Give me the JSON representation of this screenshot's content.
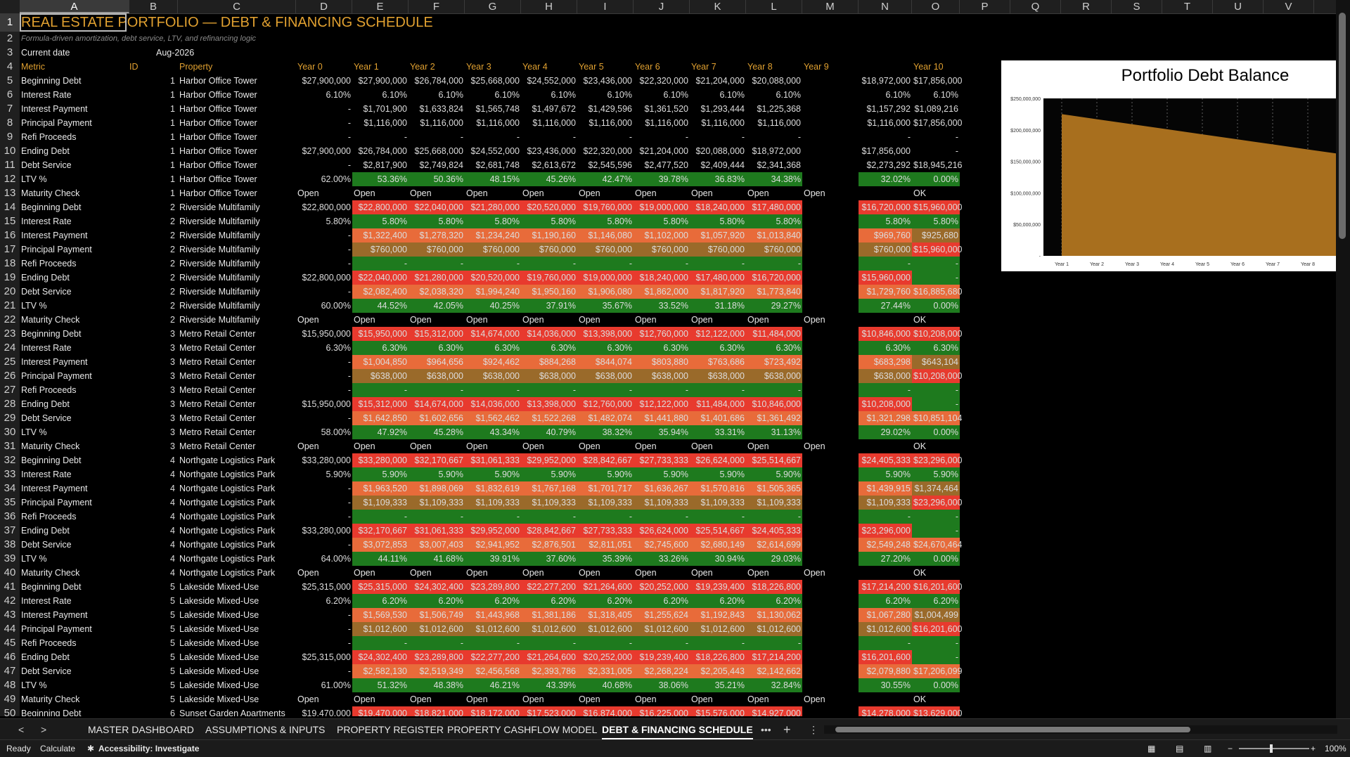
{
  "columns": [
    "A",
    "B",
    "C",
    "D",
    "E",
    "F",
    "G",
    "H",
    "I",
    "J",
    "K",
    "L",
    "M",
    "N",
    "O",
    "P",
    "Q",
    "R",
    "S",
    "T",
    "U",
    "V"
  ],
  "title": "REAL ESTATE PORTFOLIO — DEBT & FINANCING SCHEDULE",
  "subtitle": "Formula-driven amortization, debt service, LTV, and refinancing logic",
  "current_date_label": "Current date",
  "current_date_value": "Aug-2026",
  "headers": [
    "Metric",
    "ID",
    "Property",
    "Year 0",
    "Year 1",
    "Year 2",
    "Year 3",
    "Year 4",
    "Year 5",
    "Year 6",
    "Year 7",
    "Year 8",
    "Year 9",
    "",
    "Year 10"
  ],
  "colors": {
    "red": "#e83a2e",
    "orange": "#e86b3a",
    "olive": "#9a6a2a",
    "green": "#1e7a1e",
    "gold": "#e0a030"
  },
  "properties": [
    {
      "id": "1",
      "name": "Harbor Office Tower",
      "rows": [
        {
          "metric": "Beginning Debt",
          "y0": "$27,900,000",
          "vals": [
            "$27,900,000",
            "$26,784,000",
            "$25,668,000",
            "$24,552,000",
            "$23,436,000",
            "$22,320,000",
            "$21,204,000",
            "$20,088,000",
            "",
            "$18,972,000",
            "$17,856,000"
          ]
        },
        {
          "metric": "Interest Rate",
          "y0": "6.10%",
          "vals": [
            "6.10%",
            "6.10%",
            "6.10%",
            "6.10%",
            "6.10%",
            "6.10%",
            "6.10%",
            "6.10%",
            "",
            "6.10%",
            "6.10%"
          ]
        },
        {
          "metric": "Interest Payment",
          "y0": "-",
          "vals": [
            "$1,701,900",
            "$1,633,824",
            "$1,565,748",
            "$1,497,672",
            "$1,429,596",
            "$1,361,520",
            "$1,293,444",
            "$1,225,368",
            "",
            "$1,157,292",
            "$1,089,216"
          ]
        },
        {
          "metric": "Principal Payment",
          "y0": "-",
          "vals": [
            "$1,116,000",
            "$1,116,000",
            "$1,116,000",
            "$1,116,000",
            "$1,116,000",
            "$1,116,000",
            "$1,116,000",
            "$1,116,000",
            "",
            "$1,116,000",
            "$17,856,000"
          ]
        },
        {
          "metric": "Refi Proceeds",
          "y0": "-",
          "vals": [
            "-",
            "-",
            "-",
            "-",
            "-",
            "-",
            "-",
            "-",
            "",
            "-",
            "-"
          ]
        },
        {
          "metric": "Ending Debt",
          "y0": "$27,900,000",
          "vals": [
            "$26,784,000",
            "$25,668,000",
            "$24,552,000",
            "$23,436,000",
            "$22,320,000",
            "$21,204,000",
            "$20,088,000",
            "$18,972,000",
            "",
            "$17,856,000",
            "-"
          ]
        },
        {
          "metric": "Debt Service",
          "y0": "-",
          "vals": [
            "$2,817,900",
            "$2,749,824",
            "$2,681,748",
            "$2,613,672",
            "$2,545,596",
            "$2,477,520",
            "$2,409,444",
            "$2,341,368",
            "",
            "$2,273,292",
            "$18,945,216"
          ]
        },
        {
          "metric": "LTV %",
          "y0": "62.00%",
          "vals": [
            "53.36%",
            "50.36%",
            "48.15%",
            "45.26%",
            "42.47%",
            "39.78%",
            "36.83%",
            "34.38%",
            "",
            "32.02%",
            "0.00%"
          ]
        },
        {
          "metric": "Maturity Check",
          "y0": "Open",
          "vals": [
            "Open",
            "Open",
            "Open",
            "Open",
            "Open",
            "Open",
            "Open",
            "Open",
            "Open",
            "",
            "OK"
          ]
        }
      ]
    },
    {
      "id": "2",
      "name": "Riverside Multifamily",
      "rows": [
        {
          "metric": "Beginning Debt",
          "y0": "$22,800,000",
          "vals": [
            "$22,800,000",
            "$22,040,000",
            "$21,280,000",
            "$20,520,000",
            "$19,760,000",
            "$19,000,000",
            "$18,240,000",
            "$17,480,000",
            "",
            "$16,720,000",
            "$15,960,000"
          ]
        },
        {
          "metric": "Interest Rate",
          "y0": "5.80%",
          "vals": [
            "5.80%",
            "5.80%",
            "5.80%",
            "5.80%",
            "5.80%",
            "5.80%",
            "5.80%",
            "5.80%",
            "",
            "5.80%",
            "5.80%"
          ]
        },
        {
          "metric": "Interest Payment",
          "y0": "-",
          "vals": [
            "$1,322,400",
            "$1,278,320",
            "$1,234,240",
            "$1,190,160",
            "$1,146,080",
            "$1,102,000",
            "$1,057,920",
            "$1,013,840",
            "",
            "$969,760",
            "$925,680"
          ]
        },
        {
          "metric": "Principal Payment",
          "y0": "-",
          "vals": [
            "$760,000",
            "$760,000",
            "$760,000",
            "$760,000",
            "$760,000",
            "$760,000",
            "$760,000",
            "$760,000",
            "",
            "$760,000",
            "$15,960,000"
          ]
        },
        {
          "metric": "Refi Proceeds",
          "y0": "-",
          "vals": [
            "-",
            "-",
            "-",
            "-",
            "-",
            "-",
            "-",
            "-",
            "",
            "-",
            "-"
          ]
        },
        {
          "metric": "Ending Debt",
          "y0": "$22,800,000",
          "vals": [
            "$22,040,000",
            "$21,280,000",
            "$20,520,000",
            "$19,760,000",
            "$19,000,000",
            "$18,240,000",
            "$17,480,000",
            "$16,720,000",
            "",
            "$15,960,000",
            "-"
          ]
        },
        {
          "metric": "Debt Service",
          "y0": "-",
          "vals": [
            "$2,082,400",
            "$2,038,320",
            "$1,994,240",
            "$1,950,160",
            "$1,906,080",
            "$1,862,000",
            "$1,817,920",
            "$1,773,840",
            "",
            "$1,729,760",
            "$16,885,680"
          ]
        },
        {
          "metric": "LTV %",
          "y0": "60.00%",
          "vals": [
            "44.52%",
            "42.05%",
            "40.25%",
            "37.91%",
            "35.67%",
            "33.52%",
            "31.18%",
            "29.27%",
            "",
            "27.44%",
            "0.00%"
          ]
        },
        {
          "metric": "Maturity Check",
          "y0": "Open",
          "vals": [
            "Open",
            "Open",
            "Open",
            "Open",
            "Open",
            "Open",
            "Open",
            "Open",
            "Open",
            "",
            "OK"
          ]
        }
      ]
    },
    {
      "id": "3",
      "name": "Metro Retail Center",
      "rows": [
        {
          "metric": "Beginning Debt",
          "y0": "$15,950,000",
          "vals": [
            "$15,950,000",
            "$15,312,000",
            "$14,674,000",
            "$14,036,000",
            "$13,398,000",
            "$12,760,000",
            "$12,122,000",
            "$11,484,000",
            "",
            "$10,846,000",
            "$10,208,000"
          ]
        },
        {
          "metric": "Interest Rate",
          "y0": "6.30%",
          "vals": [
            "6.30%",
            "6.30%",
            "6.30%",
            "6.30%",
            "6.30%",
            "6.30%",
            "6.30%",
            "6.30%",
            "",
            "6.30%",
            "6.30%"
          ]
        },
        {
          "metric": "Interest Payment",
          "y0": "-",
          "vals": [
            "$1,004,850",
            "$964,656",
            "$924,462",
            "$884,268",
            "$844,074",
            "$803,880",
            "$763,686",
            "$723,492",
            "",
            "$683,298",
            "$643,104"
          ]
        },
        {
          "metric": "Principal Payment",
          "y0": "-",
          "vals": [
            "$638,000",
            "$638,000",
            "$638,000",
            "$638,000",
            "$638,000",
            "$638,000",
            "$638,000",
            "$638,000",
            "",
            "$638,000",
            "$10,208,000"
          ]
        },
        {
          "metric": "Refi Proceeds",
          "y0": "-",
          "vals": [
            "-",
            "-",
            "-",
            "-",
            "-",
            "-",
            "-",
            "-",
            "",
            "-",
            "-"
          ]
        },
        {
          "metric": "Ending Debt",
          "y0": "$15,950,000",
          "vals": [
            "$15,312,000",
            "$14,674,000",
            "$14,036,000",
            "$13,398,000",
            "$12,760,000",
            "$12,122,000",
            "$11,484,000",
            "$10,846,000",
            "",
            "$10,208,000",
            "-"
          ]
        },
        {
          "metric": "Debt Service",
          "y0": "-",
          "vals": [
            "$1,642,850",
            "$1,602,656",
            "$1,562,462",
            "$1,522,268",
            "$1,482,074",
            "$1,441,880",
            "$1,401,686",
            "$1,361,492",
            "",
            "$1,321,298",
            "$10,851,104"
          ]
        },
        {
          "metric": "LTV %",
          "y0": "58.00%",
          "vals": [
            "47.92%",
            "45.28%",
            "43.34%",
            "40.79%",
            "38.32%",
            "35.94%",
            "33.31%",
            "31.13%",
            "",
            "29.02%",
            "0.00%"
          ]
        },
        {
          "metric": "Maturity Check",
          "y0": "Open",
          "vals": [
            "Open",
            "Open",
            "Open",
            "Open",
            "Open",
            "Open",
            "Open",
            "Open",
            "Open",
            "",
            "OK"
          ]
        }
      ]
    },
    {
      "id": "4",
      "name": "Northgate Logistics Park",
      "rows": [
        {
          "metric": "Beginning Debt",
          "y0": "$33,280,000",
          "vals": [
            "$33,280,000",
            "$32,170,667",
            "$31,061,333",
            "$29,952,000",
            "$28,842,667",
            "$27,733,333",
            "$26,624,000",
            "$25,514,667",
            "",
            "$24,405,333",
            "$23,296,000"
          ]
        },
        {
          "metric": "Interest Rate",
          "y0": "5.90%",
          "vals": [
            "5.90%",
            "5.90%",
            "5.90%",
            "5.90%",
            "5.90%",
            "5.90%",
            "5.90%",
            "5.90%",
            "",
            "5.90%",
            "5.90%"
          ]
        },
        {
          "metric": "Interest Payment",
          "y0": "-",
          "vals": [
            "$1,963,520",
            "$1,898,069",
            "$1,832,619",
            "$1,767,168",
            "$1,701,717",
            "$1,636,267",
            "$1,570,816",
            "$1,505,365",
            "",
            "$1,439,915",
            "$1,374,464"
          ]
        },
        {
          "metric": "Principal Payment",
          "y0": "-",
          "vals": [
            "$1,109,333",
            "$1,109,333",
            "$1,109,333",
            "$1,109,333",
            "$1,109,333",
            "$1,109,333",
            "$1,109,333",
            "$1,109,333",
            "",
            "$1,109,333",
            "$23,296,000"
          ]
        },
        {
          "metric": "Refi Proceeds",
          "y0": "-",
          "vals": [
            "-",
            "-",
            "-",
            "-",
            "-",
            "-",
            "-",
            "-",
            "",
            "-",
            "-"
          ]
        },
        {
          "metric": "Ending Debt",
          "y0": "$33,280,000",
          "vals": [
            "$32,170,667",
            "$31,061,333",
            "$29,952,000",
            "$28,842,667",
            "$27,733,333",
            "$26,624,000",
            "$25,514,667",
            "$24,405,333",
            "",
            "$23,296,000",
            "-"
          ]
        },
        {
          "metric": "Debt Service",
          "y0": "-",
          "vals": [
            "$3,072,853",
            "$3,007,403",
            "$2,941,952",
            "$2,876,501",
            "$2,811,051",
            "$2,745,600",
            "$2,680,149",
            "$2,614,699",
            "",
            "$2,549,248",
            "$24,670,464"
          ]
        },
        {
          "metric": "LTV %",
          "y0": "64.00%",
          "vals": [
            "44.11%",
            "41.68%",
            "39.91%",
            "37.60%",
            "35.39%",
            "33.26%",
            "30.94%",
            "29.03%",
            "",
            "27.20%",
            "0.00%"
          ]
        },
        {
          "metric": "Maturity Check",
          "y0": "Open",
          "vals": [
            "Open",
            "Open",
            "Open",
            "Open",
            "Open",
            "Open",
            "Open",
            "Open",
            "Open",
            "",
            "OK"
          ]
        }
      ]
    },
    {
      "id": "5",
      "name": "Lakeside Mixed-Use",
      "rows": [
        {
          "metric": "Beginning Debt",
          "y0": "$25,315,000",
          "vals": [
            "$25,315,000",
            "$24,302,400",
            "$23,289,800",
            "$22,277,200",
            "$21,264,600",
            "$20,252,000",
            "$19,239,400",
            "$18,226,800",
            "",
            "$17,214,200",
            "$16,201,600"
          ]
        },
        {
          "metric": "Interest Rate",
          "y0": "6.20%",
          "vals": [
            "6.20%",
            "6.20%",
            "6.20%",
            "6.20%",
            "6.20%",
            "6.20%",
            "6.20%",
            "6.20%",
            "",
            "6.20%",
            "6.20%"
          ]
        },
        {
          "metric": "Interest Payment",
          "y0": "-",
          "vals": [
            "$1,569,530",
            "$1,506,749",
            "$1,443,968",
            "$1,381,186",
            "$1,318,405",
            "$1,255,624",
            "$1,192,843",
            "$1,130,062",
            "",
            "$1,067,280",
            "$1,004,499"
          ]
        },
        {
          "metric": "Principal Payment",
          "y0": "-",
          "vals": [
            "$1,012,600",
            "$1,012,600",
            "$1,012,600",
            "$1,012,600",
            "$1,012,600",
            "$1,012,600",
            "$1,012,600",
            "$1,012,600",
            "",
            "$1,012,600",
            "$16,201,600"
          ]
        },
        {
          "metric": "Refi Proceeds",
          "y0": "-",
          "vals": [
            "-",
            "-",
            "-",
            "-",
            "-",
            "-",
            "-",
            "-",
            "",
            "-",
            "-"
          ]
        },
        {
          "metric": "Ending Debt",
          "y0": "$25,315,000",
          "vals": [
            "$24,302,400",
            "$23,289,800",
            "$22,277,200",
            "$21,264,600",
            "$20,252,000",
            "$19,239,400",
            "$18,226,800",
            "$17,214,200",
            "",
            "$16,201,600",
            "-"
          ]
        },
        {
          "metric": "Debt Service",
          "y0": "-",
          "vals": [
            "$2,582,130",
            "$2,519,349",
            "$2,456,568",
            "$2,393,786",
            "$2,331,005",
            "$2,268,224",
            "$2,205,443",
            "$2,142,662",
            "",
            "$2,079,880",
            "$17,206,099"
          ]
        },
        {
          "metric": "LTV %",
          "y0": "61.00%",
          "vals": [
            "51.32%",
            "48.38%",
            "46.21%",
            "43.39%",
            "40.68%",
            "38.06%",
            "35.21%",
            "32.84%",
            "",
            "30.55%",
            "0.00%"
          ]
        },
        {
          "metric": "Maturity Check",
          "y0": "Open",
          "vals": [
            "Open",
            "Open",
            "Open",
            "Open",
            "Open",
            "Open",
            "Open",
            "Open",
            "Open",
            "",
            "OK"
          ]
        }
      ]
    },
    {
      "id": "6",
      "name": "Sunset Garden Apartments",
      "rows": [
        {
          "metric": "Beginning Debt",
          "y0": "$19,470,000",
          "vals": [
            "$19,470,000",
            "$18,821,000",
            "$18,172,000",
            "$17,523,000",
            "$16,874,000",
            "$16,225,000",
            "$15,576,000",
            "$14,927,000",
            "",
            "$14,278,000",
            "$13,629,000"
          ]
        }
      ]
    }
  ],
  "chart_data": {
    "type": "area",
    "title": "Portfolio Debt Balance",
    "categories": [
      "Year 1",
      "Year 2",
      "Year 3",
      "Year 4",
      "Year 5",
      "Year 6",
      "Year 7",
      "Year 8"
    ],
    "series": [
      {
        "values": [
          225000000,
          217000000,
          209000000,
          201000000,
          193000000,
          185000000,
          177000000,
          169000000
        ]
      }
    ],
    "yticks": [
      "$250,000,000",
      "$200,000,000",
      "$150,000,000",
      "$100,000,000",
      "$50,000,000",
      "-"
    ],
    "ylim": [
      0,
      250000000
    ],
    "grid": true,
    "color": "#a86f1e"
  },
  "tabs": [
    "MASTER DASHBOARD",
    "ASSUMPTIONS & INPUTS",
    "PROPERTY REGISTER",
    "PROPERTY CASHFLOW MODEL",
    "DEBT & FINANCING SCHEDULE"
  ],
  "active_tab": "DEBT & FINANCING SCHEDULE",
  "tab_more": "•••",
  "tab_add": "+",
  "tab_options": "⋮",
  "nav_prev": "<",
  "nav_next": ">",
  "status": {
    "ready": "Ready",
    "calculate": "Calculate",
    "accessibility": "Accessibility: Investigate",
    "zoom": "100%",
    "minus": "−",
    "plus": "+"
  }
}
